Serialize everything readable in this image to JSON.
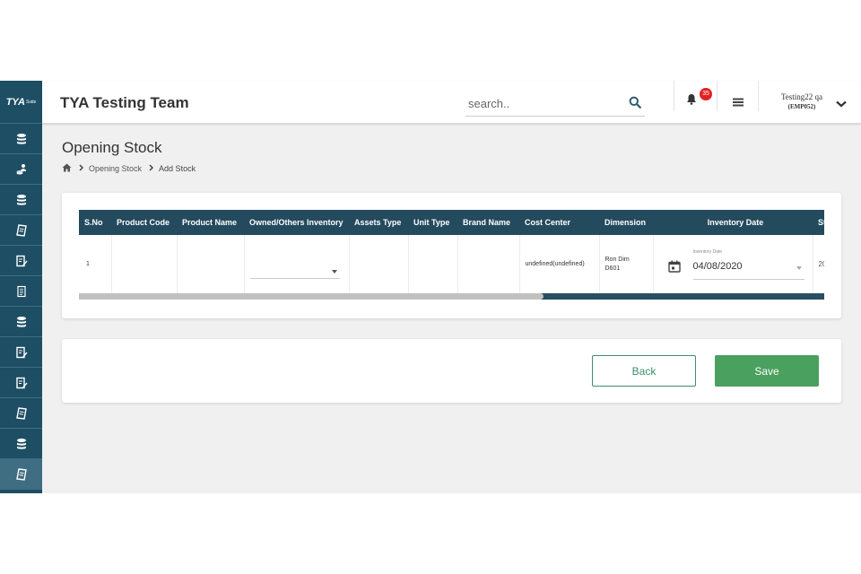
{
  "app": {
    "logo_text": "TYA",
    "logo_sub": "Suite",
    "title": "TYA Testing Team"
  },
  "colors": {
    "sidebar": "#1d4e64",
    "table_header": "#244a5e",
    "save_button": "#4aa05e",
    "badge": "#e32222"
  },
  "sidebar": {
    "items": [
      {
        "icon": "stack-icon"
      },
      {
        "icon": "user-coins-icon"
      },
      {
        "icon": "stack-icon"
      },
      {
        "icon": "note-icon"
      },
      {
        "icon": "edit-icon"
      },
      {
        "icon": "document-icon"
      },
      {
        "icon": "stack-icon"
      },
      {
        "icon": "edit-icon"
      },
      {
        "icon": "edit-icon"
      },
      {
        "icon": "note-icon"
      },
      {
        "icon": "stack-icon"
      },
      {
        "icon": "note-icon",
        "active": true
      }
    ]
  },
  "header": {
    "search_placeholder": "search..",
    "notification_count": "35",
    "user_name": "Testing22 qa",
    "user_code": "(EMP052)"
  },
  "page": {
    "title": "Opening Stock",
    "breadcrumb": [
      "Opening Stock",
      "Add Stock"
    ]
  },
  "table": {
    "columns": [
      "S.No",
      "Product Code",
      "Product Name",
      "Owned/Others Inventory",
      "Assets Type",
      "Unit Type",
      "Brand Name",
      "Cost Center",
      "Dimension",
      "Inventory Date",
      "St"
    ],
    "rows": [
      {
        "sno": "1",
        "product_code": "",
        "product_name": "",
        "owned": "",
        "assets_type": "",
        "unit_type": "",
        "brand_name": "",
        "cost_center": "undefined(undefined)",
        "dimension_line1": "Ron Dim",
        "dimension_line2": "D601",
        "inventory_date_label": "Inventory Date",
        "inventory_date": "04/08/2020",
        "next": "20"
      }
    ]
  },
  "actions": {
    "back_label": "Back",
    "save_label": "Save"
  }
}
